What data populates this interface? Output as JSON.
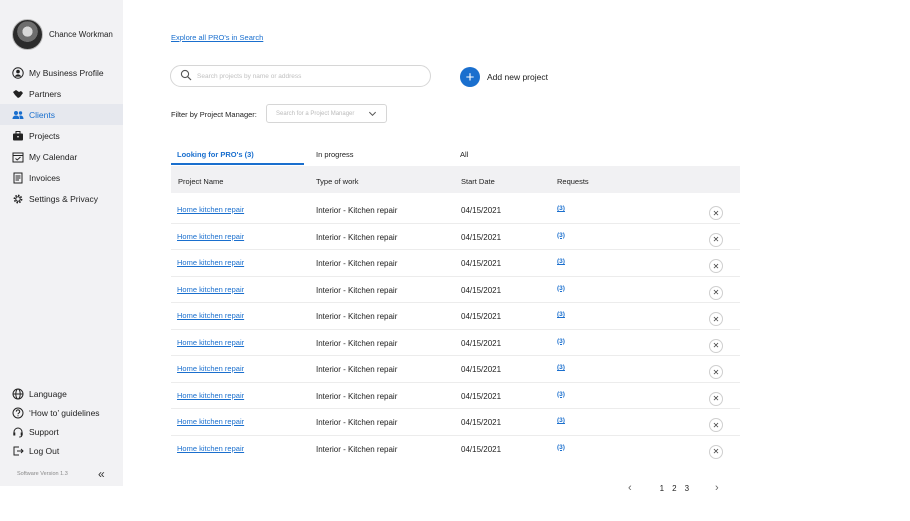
{
  "user": {
    "name": "Chance Workman"
  },
  "nav": {
    "items": [
      {
        "label": "My Business Profile",
        "icon": "user-circle-icon",
        "active": false
      },
      {
        "label": "Partners",
        "icon": "handshake-icon",
        "active": false
      },
      {
        "label": "Clients",
        "icon": "users-icon",
        "active": true
      },
      {
        "label": "Projects",
        "icon": "briefcase-icon",
        "active": false
      },
      {
        "label": "My Calendar",
        "icon": "calendar-icon",
        "active": false
      },
      {
        "label": "Invoices",
        "icon": "invoice-icon",
        "active": false
      },
      {
        "label": "Settings & Privacy",
        "icon": "gear-icon",
        "active": false
      }
    ],
    "bottom": [
      {
        "label": "Language",
        "icon": "globe-icon"
      },
      {
        "label": "‘How to’ guidelines",
        "icon": "question-icon"
      },
      {
        "label": "Support",
        "icon": "headset-icon"
      },
      {
        "label": "Log Out",
        "icon": "logout-icon"
      }
    ],
    "version": "Software Version    1.3"
  },
  "main": {
    "explore_link": "Explore all PRO's in Search",
    "search_placeholder": "Search projects by name or address",
    "add_project_label": "Add new project",
    "filter_label": "Filter by Project Manager:",
    "filter_placeholder": "Search for a Project Manager",
    "tabs": [
      "Looking for PRO's (3)",
      "In progress",
      "All"
    ],
    "columns": [
      "Project Name",
      "Type of work",
      "Start Date",
      "Requests"
    ],
    "rows": [
      {
        "name": "Home kitchen repair",
        "type": "Interior - Kitchen repair",
        "date": "04/15/2021",
        "requests": "(3)"
      },
      {
        "name": "Home kitchen repair",
        "type": "Interior - Kitchen repair",
        "date": "04/15/2021",
        "requests": "(3)"
      },
      {
        "name": "Home kitchen repair",
        "type": "Interior - Kitchen repair",
        "date": "04/15/2021",
        "requests": "(3)"
      },
      {
        "name": "Home kitchen repair",
        "type": "Interior - Kitchen repair",
        "date": "04/15/2021",
        "requests": "(3)"
      },
      {
        "name": "Home kitchen repair",
        "type": "Interior - Kitchen repair",
        "date": "04/15/2021",
        "requests": "(3)"
      },
      {
        "name": "Home kitchen repair",
        "type": "Interior - Kitchen repair",
        "date": "04/15/2021",
        "requests": "(3)"
      },
      {
        "name": "Home kitchen repair",
        "type": "Interior - Kitchen repair",
        "date": "04/15/2021",
        "requests": "(3)"
      },
      {
        "name": "Home kitchen repair",
        "type": "Interior - Kitchen repair",
        "date": "04/15/2021",
        "requests": "(3)"
      },
      {
        "name": "Home kitchen repair",
        "type": "Interior - Kitchen repair",
        "date": "04/15/2021",
        "requests": "(3)"
      },
      {
        "name": "Home kitchen repair",
        "type": "Interior - Kitchen repair",
        "date": "04/15/2021",
        "requests": "(3)"
      }
    ],
    "pagination": {
      "pages": [
        "1",
        "2",
        "3"
      ],
      "prev": "‹",
      "next": "›"
    }
  },
  "colors": {
    "accent": "#1a6fce",
    "sidebar_bg": "#f2f2f4",
    "header_bg": "#f1f1f3"
  }
}
